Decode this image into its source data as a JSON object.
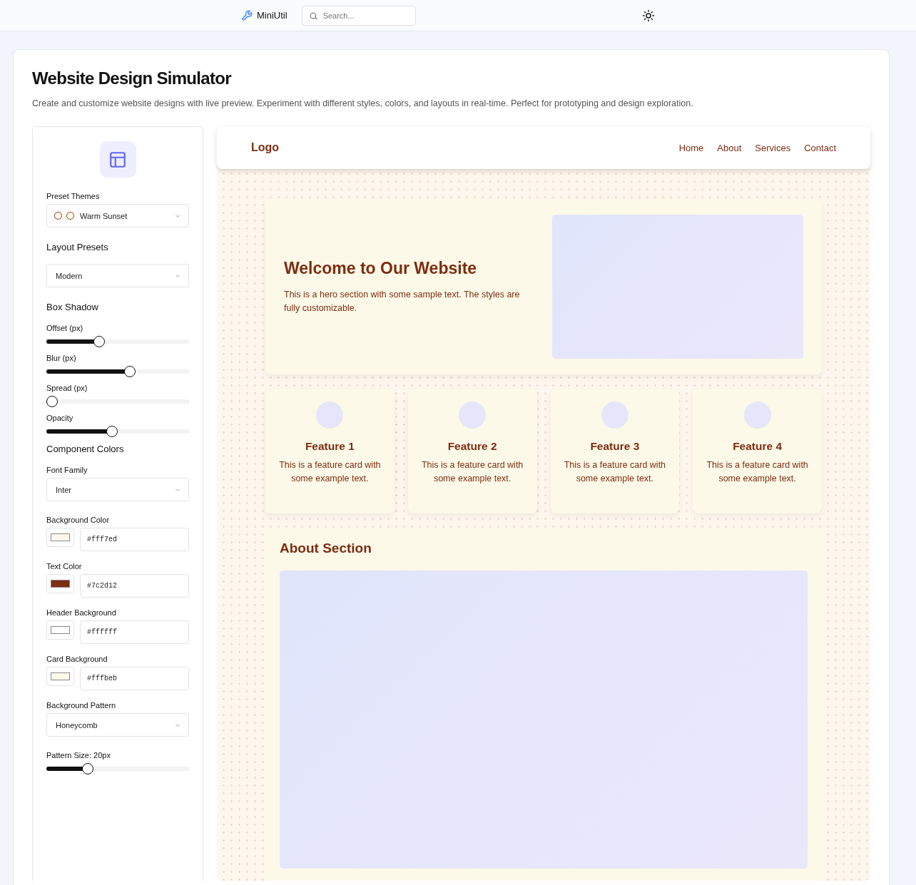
{
  "topbar": {
    "brand": "MiniUtil",
    "search": {
      "placeholder": "Search..."
    }
  },
  "page": {
    "title": "Website Design Simulator",
    "description": "Create and customize website designs with live preview. Experiment with different styles, colors, and layouts in real-time. Perfect for prototyping and design exploration."
  },
  "sidebar": {
    "controls": [
      {
        "kind": "select",
        "label": "Preset Themes",
        "value": "Warm Sunset",
        "swatches": [
          {
            "color": "#fff7ed"
          },
          {
            "color": "#fffbeb"
          }
        ]
      },
      {
        "kind": "heading",
        "label": "Layout Presets"
      },
      {
        "kind": "select",
        "value": "Modern"
      },
      {
        "kind": "heading",
        "label": "Box Shadow"
      },
      {
        "kind": "slider",
        "label": "Offset (px)",
        "level": 0.36
      },
      {
        "kind": "slider",
        "label": "Blur (px)",
        "level": 0.59
      },
      {
        "kind": "slider",
        "label": "Spread (px)",
        "level": 0
      },
      {
        "kind": "slider",
        "label": "Opacity",
        "level": 0.455
      },
      {
        "kind": "heading",
        "label": "Component Colors"
      },
      {
        "kind": "select",
        "label": "Font Family",
        "value": "Inter"
      },
      {
        "kind": "color",
        "label": "Background Color",
        "value": "#fff7ed",
        "color": "#fff7ed"
      },
      {
        "kind": "color",
        "label": "Text Color",
        "value": "#7c2d12",
        "color": "#7c2d12"
      },
      {
        "kind": "color",
        "label": "Header Background",
        "value": "#ffffff",
        "color": "#ffffff"
      },
      {
        "kind": "color",
        "label": "Card Background",
        "value": "#fffbeb",
        "color": "#fffbeb"
      },
      {
        "kind": "select",
        "label": "Background Pattern",
        "value": "Honeycomb"
      },
      {
        "kind": "slider",
        "label": "Pattern Size: 20px",
        "level": 0.27
      }
    ]
  },
  "preview": {
    "header": {
      "logo": "Logo",
      "nav": [
        "Home",
        "About",
        "Services",
        "Contact"
      ]
    },
    "hero": {
      "title": "Welcome to Our Website",
      "text": "This is a hero section with some sample text. The styles are fully customizable."
    },
    "features": [
      {
        "title": "Feature 1",
        "text": "This is a feature card with some example text."
      },
      {
        "title": "Feature 2",
        "text": "This is a feature card with some example text."
      },
      {
        "title": "Feature 3",
        "text": "This is a feature card with some example text."
      },
      {
        "title": "Feature 4",
        "text": "This is a feature card with some example text."
      }
    ],
    "about": {
      "title": "About Section"
    }
  }
}
